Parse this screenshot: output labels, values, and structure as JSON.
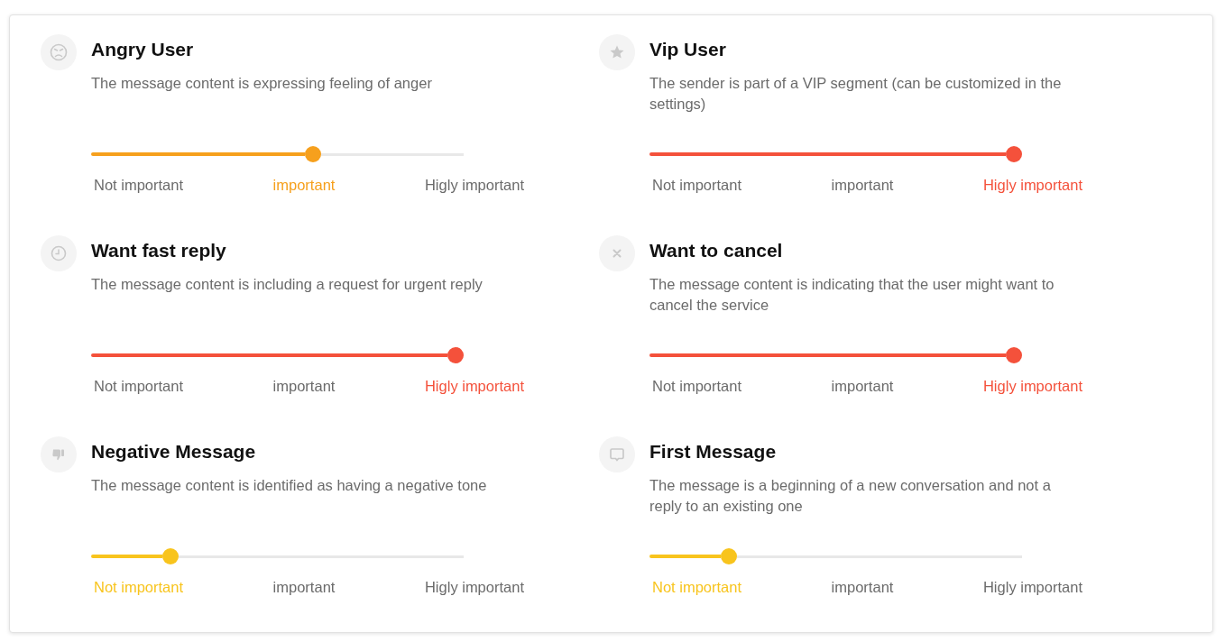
{
  "rules": [
    {
      "title": "Angry User",
      "description": "The message content is expressing feeling of anger",
      "level": 0.6,
      "color": "#f6a01d",
      "labels": [
        {
          "text": "Not important",
          "selected": false
        },
        {
          "text": "important",
          "selected": true
        },
        {
          "text": "Higly important",
          "selected": false
        }
      ]
    },
    {
      "title": "Vip User",
      "description": "The sender is part of a VIP segment (can be customized in the settings)",
      "level": 1,
      "color": "#f4513b",
      "labels": [
        {
          "text": "Not important",
          "selected": false
        },
        {
          "text": "important",
          "selected": false
        },
        {
          "text": "Higly important",
          "selected": true
        }
      ]
    },
    {
      "title": "Want fast reply",
      "description": "The message content is including a request for urgent reply",
      "level": 1,
      "color": "#f4513b",
      "labels": [
        {
          "text": "Not important",
          "selected": false
        },
        {
          "text": "important",
          "selected": false
        },
        {
          "text": "Higly important",
          "selected": true
        }
      ]
    },
    {
      "title": "Want to cancel",
      "description": "The message content is indicating that the user might want to cancel the service",
      "level": 1,
      "color": "#f4513b",
      "labels": [
        {
          "text": "Not important",
          "selected": false
        },
        {
          "text": "important",
          "selected": false
        },
        {
          "text": "Higly important",
          "selected": true
        }
      ]
    },
    {
      "title": "Negative Message",
      "description": "The message content is identified as having a negative tone",
      "level": 0.2,
      "color": "#f8c41d",
      "labels": [
        {
          "text": "Not important",
          "selected": true
        },
        {
          "text": "important",
          "selected": false
        },
        {
          "text": "Higly important",
          "selected": false
        }
      ]
    },
    {
      "title": "First Message",
      "description": "The message is a beginning of a new conversation and not a reply to an existing one",
      "level": 0.2,
      "color": "#f8c41d",
      "labels": [
        {
          "text": "Not important",
          "selected": true
        },
        {
          "text": "important",
          "selected": false
        },
        {
          "text": "Higly important",
          "selected": false
        }
      ]
    }
  ]
}
